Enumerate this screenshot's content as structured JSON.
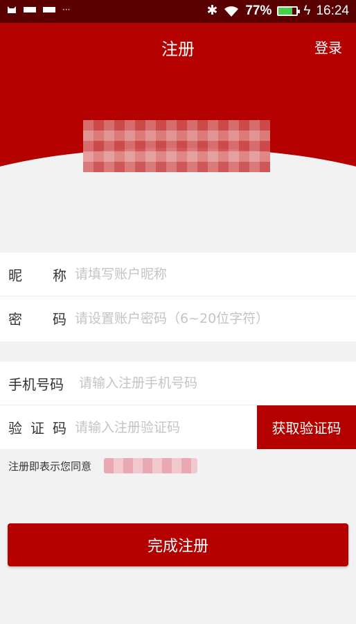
{
  "status_bar": {
    "icons": [
      "cat-icon",
      "notification-icon",
      "notification-icon"
    ],
    "more": "···",
    "bluetooth": "✱",
    "battery_percent": "77%",
    "battery_level": 0.77,
    "charging": "ϟ",
    "time": "16:24"
  },
  "header": {
    "title": "注册",
    "login_label": "登录"
  },
  "form": {
    "nickname_label": [
      "昵",
      "称"
    ],
    "nickname_placeholder": "请填写账户昵称",
    "password_label": [
      "密",
      "码"
    ],
    "password_placeholder": "请设置账户密码（6~20位字符）",
    "phone_label": "手机号码",
    "phone_placeholder": "请输入注册手机号码",
    "code_label": [
      "验",
      "证",
      "码"
    ],
    "code_placeholder": "请输入注册验证码",
    "get_code_label": "获取验证码"
  },
  "agreement": {
    "text": "注册即表示您同意"
  },
  "submit_label": "完成注册",
  "colors": {
    "primary": "#b50000",
    "status_bar": "#5a0000",
    "background": "#f2f2f2"
  }
}
